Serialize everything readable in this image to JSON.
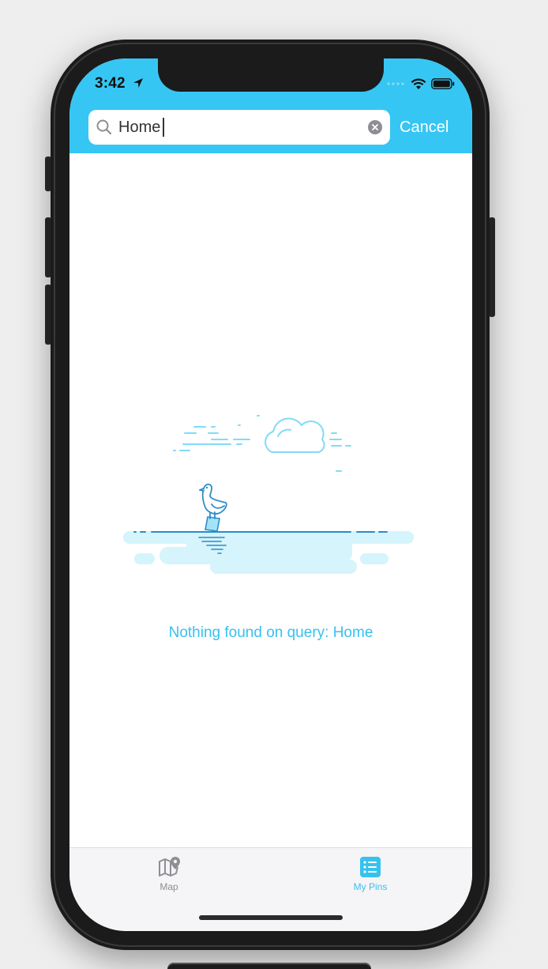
{
  "status_bar": {
    "time": "3:42",
    "icons": [
      "location-arrow-icon",
      "signal-dots-icon",
      "wifi-icon",
      "battery-icon"
    ]
  },
  "search": {
    "value": "Home",
    "icon": "search-icon",
    "clear_icon": "clear-icon",
    "cancel_label": "Cancel"
  },
  "empty_state": {
    "illustration": "seagull-on-water-illustration",
    "message": "Nothing found on query: Home"
  },
  "tab_bar": {
    "tabs": [
      {
        "label": "Map",
        "icon": "map-pin-icon",
        "selected": false
      },
      {
        "label": "My Pins",
        "icon": "list-icon",
        "selected": true
      }
    ]
  },
  "colors": {
    "accent": "#36c6f4",
    "message": "#36c2ef",
    "tab_inactive": "#8e8e93",
    "tab_active": "#36c2ef",
    "water": "#d5f4fc",
    "line": "#2c8cc8"
  }
}
